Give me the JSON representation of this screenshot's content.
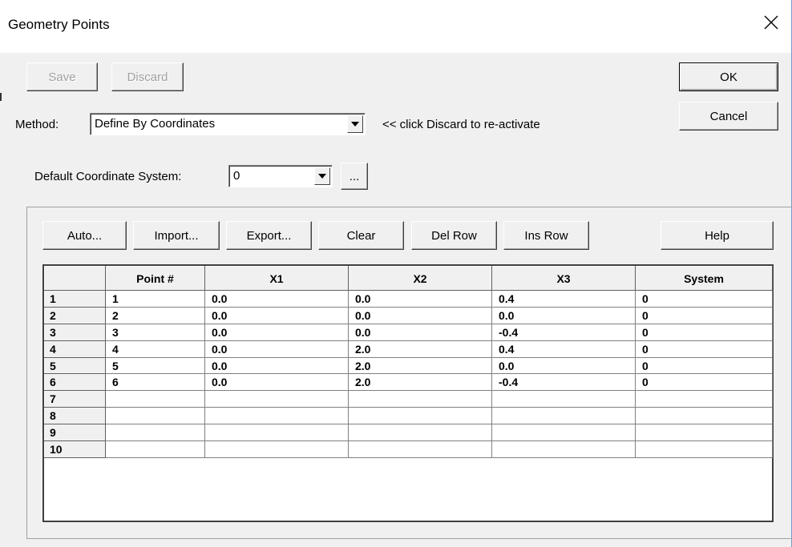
{
  "window": {
    "title": "Geometry Points"
  },
  "top_buttons": {
    "save": "Save",
    "discard": "Discard",
    "ok": "OK",
    "cancel": "Cancel"
  },
  "method": {
    "label": "Method:",
    "value": "Define By Coordinates",
    "hint": "<< click Discard to re-activate"
  },
  "coord_system": {
    "label": "Default Coordinate System:",
    "value": "0",
    "browse": "..."
  },
  "toolbar": {
    "auto": "Auto...",
    "import": "Import...",
    "export": "Export...",
    "clear": "Clear",
    "del_row": "Del Row",
    "ins_row": "Ins Row",
    "help": "Help"
  },
  "grid": {
    "columns": [
      "",
      "Point #",
      "X1",
      "X2",
      "X3",
      "System"
    ],
    "rows": [
      {
        "n": "1",
        "point": "1",
        "x1": "0.0",
        "x2": "0.0",
        "x3": "0.4",
        "system": "0"
      },
      {
        "n": "2",
        "point": "2",
        "x1": "0.0",
        "x2": "0.0",
        "x3": "0.0",
        "system": "0"
      },
      {
        "n": "3",
        "point": "3",
        "x1": "0.0",
        "x2": "0.0",
        "x3": "-0.4",
        "system": "0"
      },
      {
        "n": "4",
        "point": "4",
        "x1": "0.0",
        "x2": "2.0",
        "x3": "0.4",
        "system": "0"
      },
      {
        "n": "5",
        "point": "5",
        "x1": "0.0",
        "x2": "2.0",
        "x3": "0.0",
        "system": "0"
      },
      {
        "n": "6",
        "point": "6",
        "x1": "0.0",
        "x2": "2.0",
        "x3": "-0.4",
        "system": "0"
      },
      {
        "n": "7",
        "point": "",
        "x1": "",
        "x2": "",
        "x3": "",
        "system": ""
      },
      {
        "n": "8",
        "point": "",
        "x1": "",
        "x2": "",
        "x3": "",
        "system": ""
      },
      {
        "n": "9",
        "point": "",
        "x1": "",
        "x2": "",
        "x3": "",
        "system": ""
      },
      {
        "n": "10",
        "point": "",
        "x1": "",
        "x2": "",
        "x3": "",
        "system": ""
      }
    ]
  },
  "icons": {
    "close": "close-icon",
    "dropdown": "chevron-down-icon"
  }
}
